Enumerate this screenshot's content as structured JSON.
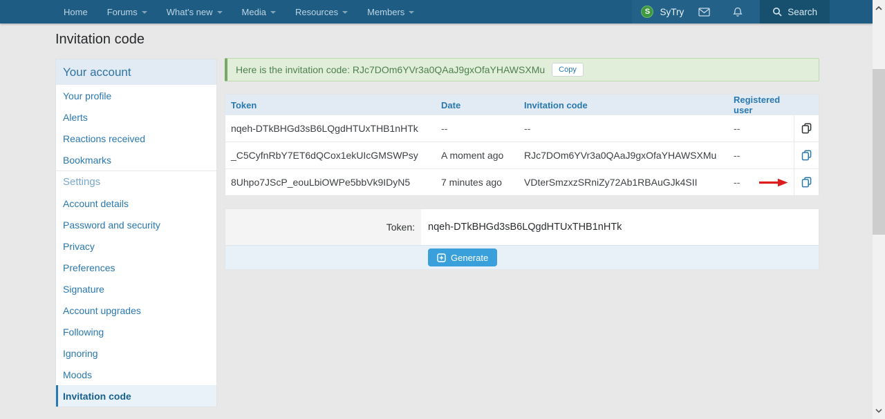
{
  "colors": {
    "accent": "#2878b1",
    "navBg": "#1e5c83",
    "navUserBg": "#236189",
    "navSearchBg": "#17506f",
    "pageBg": "#e8e8e8",
    "headerBg": "#e2ebf3",
    "selectedBg": "#e9f2f9",
    "greenBg": "#e1efda",
    "greenBorder": "#77a967",
    "greenText": "#4f7f4f",
    "red": "#dd1d1d",
    "btn": "#39a0dc",
    "avatar": "#3d9a41"
  },
  "nav": {
    "items": [
      {
        "label": "Home"
      },
      {
        "label": "Forums"
      },
      {
        "label": "What's new"
      },
      {
        "label": "Media"
      },
      {
        "label": "Resources"
      },
      {
        "label": "Members"
      }
    ],
    "user": {
      "name": "SyTry",
      "avatar_letter": "S"
    },
    "search_label": "Search"
  },
  "page": {
    "title": "Invitation code"
  },
  "sidebar": {
    "header": "Your account",
    "items": [
      {
        "label": "Your profile"
      },
      {
        "label": "Alerts"
      },
      {
        "label": "Reactions received"
      },
      {
        "label": "Bookmarks"
      },
      {
        "label": "Settings",
        "section": true
      },
      {
        "label": "Account details"
      },
      {
        "label": "Password and security"
      },
      {
        "label": "Privacy"
      },
      {
        "label": "Preferences"
      },
      {
        "label": "Signature"
      },
      {
        "label": "Account upgrades"
      },
      {
        "label": "Following"
      },
      {
        "label": "Ignoring"
      },
      {
        "label": "Moods"
      },
      {
        "label": "Invitation code",
        "selected": true
      }
    ]
  },
  "alert": {
    "text": "Here is the invitation code: RJc7DOm6YVr3a0QAaJ9gxOfaYHAWSXMu",
    "copy_label": "Copy"
  },
  "table": {
    "headers": [
      "Token",
      "Date",
      "Invitation code",
      "Registered user"
    ],
    "rows": [
      {
        "token": "nqeh-DTkBHGd3sB6LQgdHTUxTHB1nHTk",
        "date": "--",
        "invitation_code": "--",
        "registered_user": "--"
      },
      {
        "token": "_C5CyfnRbY7ET6dQCox1ekUIcGMSWPsy",
        "date": "A moment ago",
        "invitation_code": "RJc7DOm6YVr3a0QAaJ9gxOfaYHAWSXMu",
        "registered_user": "--"
      },
      {
        "token": "8Uhpo7JScP_eouLbiOWPe5bbVk9IDyN5",
        "date": "7 minutes ago",
        "invitation_code": "VDterSmzxzSRniZy72Ab1RBAuGJk4SII",
        "registered_user": "--"
      }
    ]
  },
  "form": {
    "token_label": "Token:",
    "token_value": "nqeh-DTkBHGd3sB6LQgdHTUxTHB1nHTk",
    "generate_label": "Generate"
  }
}
